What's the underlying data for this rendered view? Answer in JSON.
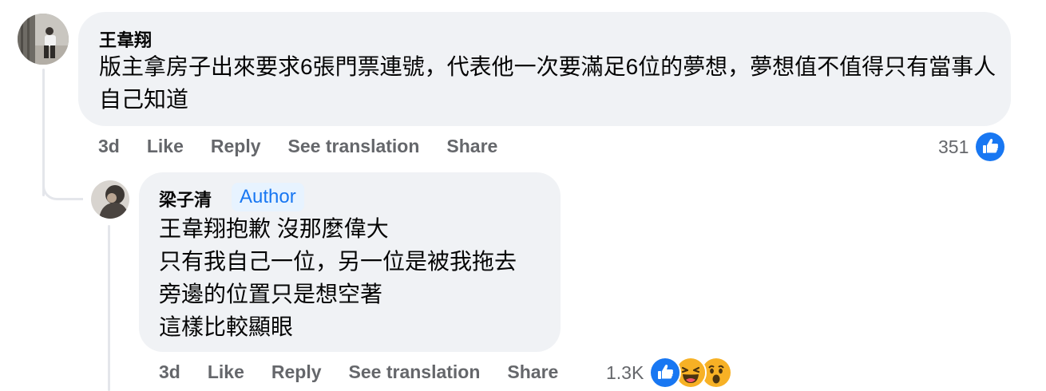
{
  "comments": [
    {
      "author": "王韋翔",
      "text": "版主拿房子出來要求6張門票連號，代表他一次要滿足6位的夢想，夢想值不值得只有當事人自己知道",
      "time": "3d",
      "actions": [
        "Like",
        "Reply",
        "See translation",
        "Share"
      ],
      "reaction_count": "351",
      "reactions": [
        "like-icon"
      ]
    },
    {
      "author": "梁子清",
      "badge": "Author",
      "text": "王韋翔抱歉 沒那麼偉大\n只有我自己一位，另一位是被我拖去\n旁邊的位置只是想空著\n這樣比較顯眼",
      "time": "3d",
      "actions": [
        "Like",
        "Reply",
        "See translation",
        "Share"
      ],
      "reaction_count": "1.3K",
      "reactions": [
        "like-icon",
        "haha-icon",
        "wow-icon"
      ]
    }
  ],
  "colors": {
    "bubble": "#f0f2f5",
    "meta_text": "#65676b",
    "like_blue": "#1877f2",
    "badge_bg": "#e7f3ff"
  }
}
